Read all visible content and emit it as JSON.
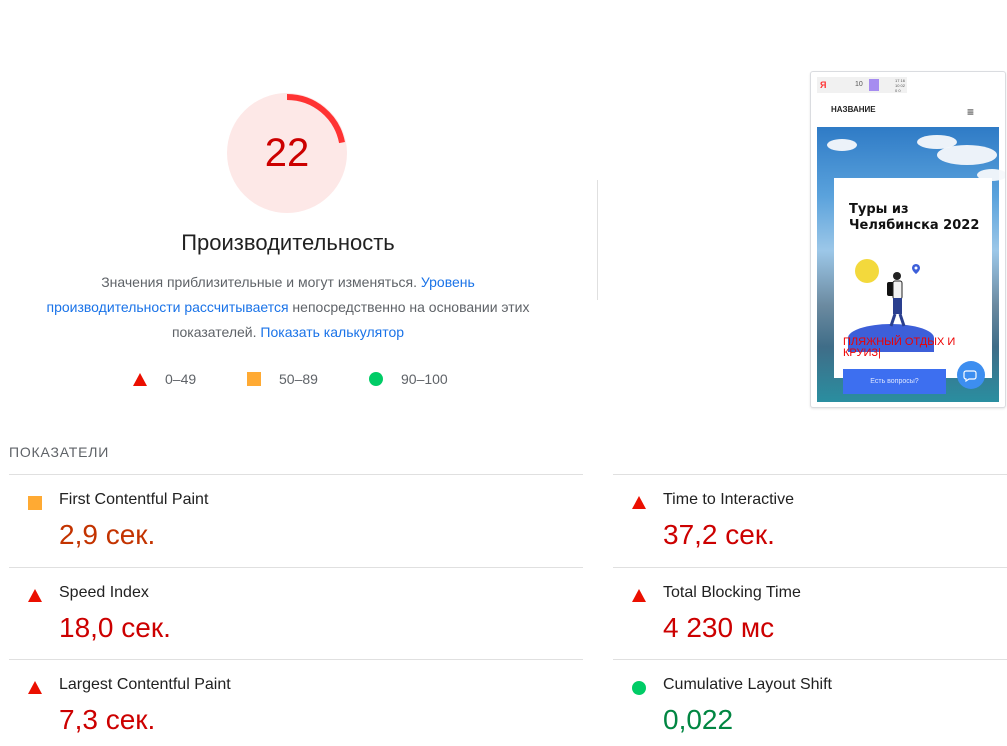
{
  "colors": {
    "fail": "#c00",
    "average": "#c33300",
    "pass": "#018642",
    "link": "#1a73e8"
  },
  "gauge": {
    "score": "22",
    "score_fraction": 0.22,
    "title": "Производительность"
  },
  "description": {
    "text_1": "Значения приблизительные и могут изменяться. ",
    "link_1": "Уровень производительности рассчитывается",
    "text_2": " непосредственно на основании этих показателей. ",
    "link_2": "Показать калькулятор"
  },
  "legend": [
    {
      "icon": "triangle-icon",
      "range": "0–49"
    },
    {
      "icon": "square-icon",
      "range": "50–89"
    },
    {
      "icon": "circle-icon",
      "range": "90–100"
    }
  ],
  "thumbnail": {
    "browser_bar": {
      "brand": "Я",
      "number": "10",
      "time": "17 16\n10 02\n0 0"
    },
    "site_name": "НАЗВАНИЕ",
    "heading": "Туры из Челябинска 2022",
    "red_text": "ПЛЯЖНЫЙ ОТДЫХ И КРУИЗ|",
    "button_label": "Есть вопросы?"
  },
  "metrics_section": {
    "title": "ПОКАЗАТЕЛИ",
    "items": [
      {
        "name": "First Contentful Paint",
        "value": "2,9 сек.",
        "status": "average",
        "icon": "square-icon"
      },
      {
        "name": "Time to Interactive",
        "value": "37,2 сек.",
        "status": "fail",
        "icon": "triangle-icon"
      },
      {
        "name": "Speed Index",
        "value": "18,0 сек.",
        "status": "fail",
        "icon": "triangle-icon"
      },
      {
        "name": "Total Blocking Time",
        "value": "4 230 мс",
        "status": "fail",
        "icon": "triangle-icon"
      },
      {
        "name": "Largest Contentful Paint",
        "value": "7,3 сек.",
        "status": "fail",
        "icon": "triangle-icon"
      },
      {
        "name": "Cumulative Layout Shift",
        "value": "0,022",
        "status": "pass",
        "icon": "circle-icon"
      }
    ]
  }
}
